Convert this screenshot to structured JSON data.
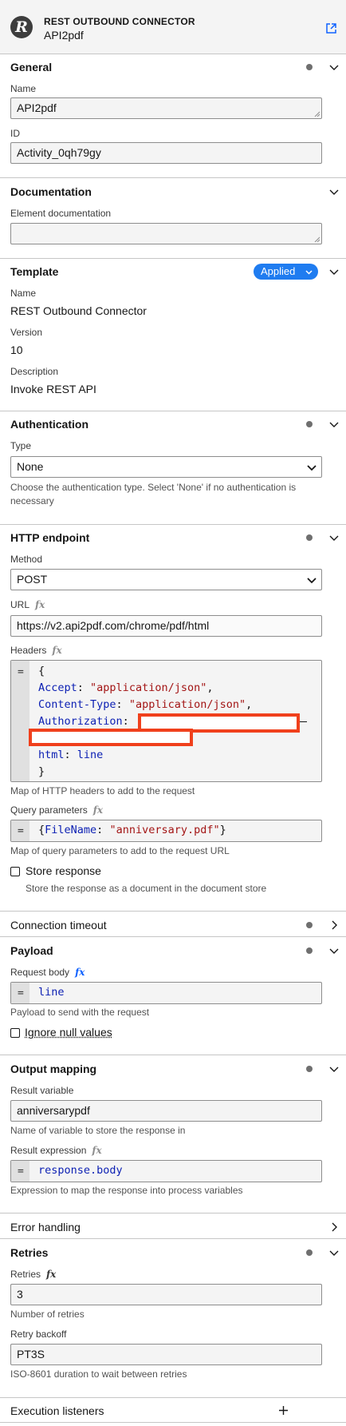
{
  "header": {
    "type": "REST OUTBOUND CONNECTOR",
    "name": "API2pdf",
    "logo_letter": "R"
  },
  "general": {
    "title": "General",
    "name_label": "Name",
    "name_value": "API2pdf",
    "id_label": "ID",
    "id_value": "Activity_0qh79gy"
  },
  "documentation": {
    "title": "Documentation",
    "label": "Element documentation",
    "value": ""
  },
  "template": {
    "title": "Template",
    "badge": "Applied",
    "name_label": "Name",
    "name_value": "REST Outbound Connector",
    "version_label": "Version",
    "version_value": "10",
    "description_label": "Description",
    "description_value": "Invoke REST API"
  },
  "authentication": {
    "title": "Authentication",
    "type_label": "Type",
    "type_value": "None",
    "help": "Choose the authentication type. Select 'None' if no authentication is necessary"
  },
  "http": {
    "title": "HTTP endpoint",
    "method_label": "Method",
    "method_value": "POST",
    "url_label": "URL",
    "url_value": "https://v2.api2pdf.com/chrome/pdf/html",
    "headers_label": "Headers",
    "headers_lines": {
      "open": "{",
      "accept_key": "Accept",
      "accept_val": "\"application/json\"",
      "ct_key": "Content-Type",
      "ct_val": "\"application/json\"",
      "auth_key": "Authorization",
      "html_key": "html",
      "html_val": "line",
      "close": "}"
    },
    "headers_help": "Map of HTTP headers to add to the request",
    "query_label": "Query parameters",
    "query_key": "FileName",
    "query_val": "\"anniversary.pdf\"",
    "query_help": "Map of query parameters to add to the request URL",
    "store_label": "Store response",
    "store_help": "Store the response as a document in the document store"
  },
  "connection_timeout": {
    "title": "Connection timeout"
  },
  "payload": {
    "title": "Payload",
    "body_label": "Request body",
    "body_value": "line",
    "body_help": "Payload to send with the request",
    "ignore_label": "Ignore null values"
  },
  "output": {
    "title": "Output mapping",
    "result_var_label": "Result variable",
    "result_var_value": "anniversarypdf",
    "result_var_help": "Name of variable to store the response in",
    "result_expr_label": "Result expression",
    "result_expr_value": "response.body",
    "result_expr_help": "Expression to map the response into process variables"
  },
  "error_handling": {
    "title": "Error handling"
  },
  "retries": {
    "title": "Retries",
    "retries_label": "Retries",
    "retries_value": "3",
    "retries_help": "Number of retries",
    "backoff_label": "Retry backoff",
    "backoff_value": "PT3S",
    "backoff_help": "ISO-8601 duration to wait between retries"
  },
  "listeners": {
    "title": "Execution listeners"
  },
  "fx_symbol": "fx",
  "eq_symbol": "=",
  "colors": {
    "accent": "#1f7cf0",
    "redaction": "#f0401c",
    "keyword": "#0b1fb3",
    "string": "#a31515"
  }
}
